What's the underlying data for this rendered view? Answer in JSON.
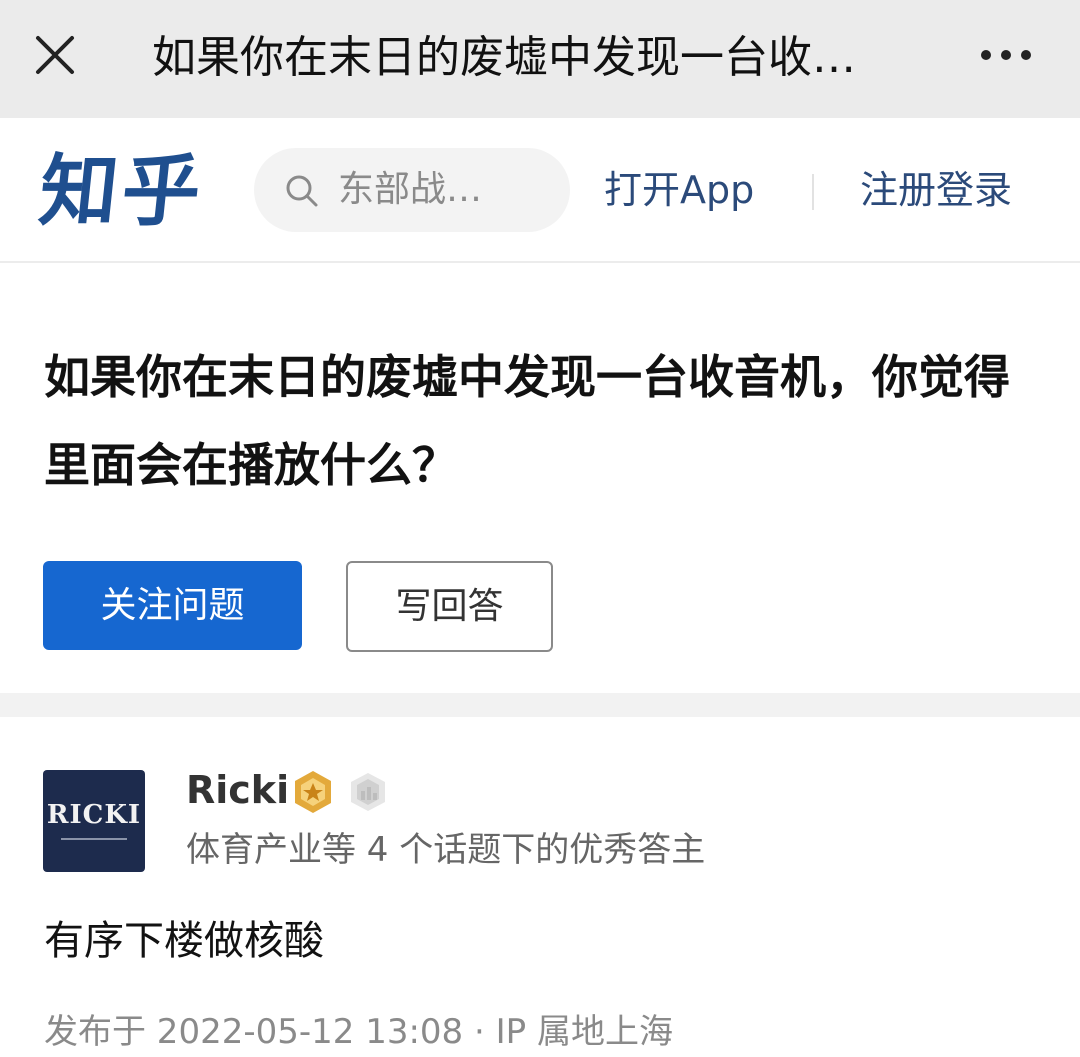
{
  "topbar": {
    "title": "如果你在末日的废墟中发现一台收…",
    "close_icon": "close-icon",
    "more_icon": "more-dots-icon"
  },
  "header": {
    "logo_text": "知乎",
    "search_placeholder": "东部战…",
    "open_app": "打开App",
    "login": "注册登录",
    "brand_color": "#1f4f8f"
  },
  "question": {
    "title": "如果你在末日的废墟中发现一台收音机，你觉得里面会在播放什么？",
    "follow_label": "关注问题",
    "write_label": "写回答",
    "follow_color": "#1667d0"
  },
  "answer": {
    "avatar_text": "RICKI",
    "author": "Ricki",
    "author_desc": "体育产业等 4 个话题下的优秀答主",
    "content": "有序下楼做核酸",
    "meta": "发布于 2022-05-12 13:08 · IP 属地上海"
  }
}
